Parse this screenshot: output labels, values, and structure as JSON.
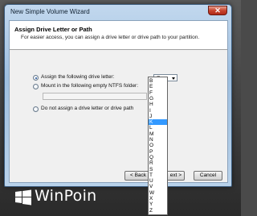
{
  "window": {
    "title": "New Simple Volume Wizard",
    "close_glyph": "✕"
  },
  "header": {
    "title": "Assign Drive Letter or Path",
    "subtitle": "For easier access, you can assign a drive letter or drive path to your partition."
  },
  "options": {
    "assign_letter": {
      "label": "Assign the following drive letter:",
      "checked": true
    },
    "mount_folder": {
      "label": "Mount in the following empty NTFS folder:",
      "checked": false
    },
    "no_assign": {
      "label": "Do not assign a drive letter or drive path",
      "checked": false
    }
  },
  "drive_letter_combo": {
    "value": "E",
    "arrow_icon": "chevron-down-icon"
  },
  "browse_button": {
    "label": "Br"
  },
  "dropdown": {
    "items": [
      "B",
      "E",
      "F",
      "G",
      "H",
      "I",
      "J",
      "K",
      "L",
      "M",
      "N",
      "O",
      "P",
      "Q",
      "R",
      "S",
      "T",
      "U",
      "V",
      "W",
      "X",
      "Y",
      "Z"
    ],
    "selected": "K"
  },
  "footer": {
    "back_label": "< Back",
    "next_label": "ext >",
    "cancel_label": "Cancel"
  },
  "watermark": {
    "text": "WinPoin",
    "logo_icon": "windows-logo-icon"
  },
  "colors": {
    "selection": "#3399ff",
    "title_bar": "#9fbfdf",
    "close_button": "#c9452f"
  }
}
